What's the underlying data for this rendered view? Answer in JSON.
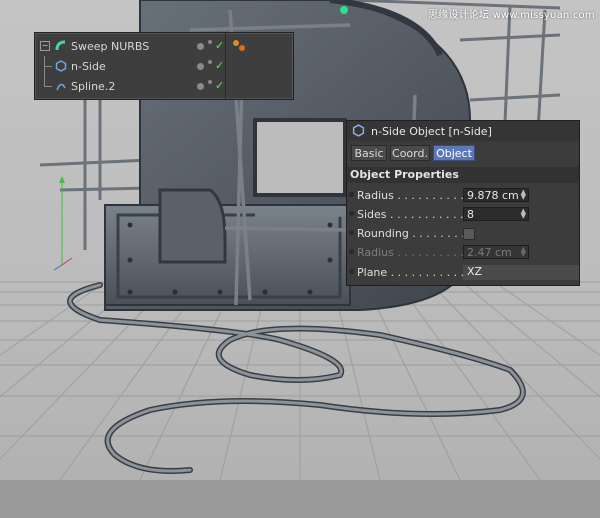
{
  "watermark": "思缘设计论坛 www.missyuan.com",
  "object_manager": {
    "rows": [
      {
        "label": "Sweep NURBS",
        "icon": "sweep-nurbs-icon"
      },
      {
        "label": "n-Side",
        "icon": "n-side-icon"
      },
      {
        "label": "Spline.2",
        "icon": "spline-icon"
      }
    ]
  },
  "attributes": {
    "title": "n-Side Object [n-Side]",
    "tabs": [
      "Basic",
      "Coord.",
      "Object"
    ],
    "active_tab": "Object",
    "section": "Object Properties",
    "params": [
      {
        "label": "Radius . . . . . . . . . . .",
        "value": "9.878 cm"
      },
      {
        "label": "Sides . . . . . . . . . . . .",
        "value": "8"
      },
      {
        "label": "Rounding . . . . . . . .",
        "value": ""
      },
      {
        "label": "Radius . . . . . . . . . . .",
        "value": "2.47 cm"
      },
      {
        "label": "Plane . . . . . . . . . . .",
        "value": "XZ"
      }
    ]
  },
  "colors": {
    "accent": "#5d78b8",
    "check": "#6be06b"
  }
}
